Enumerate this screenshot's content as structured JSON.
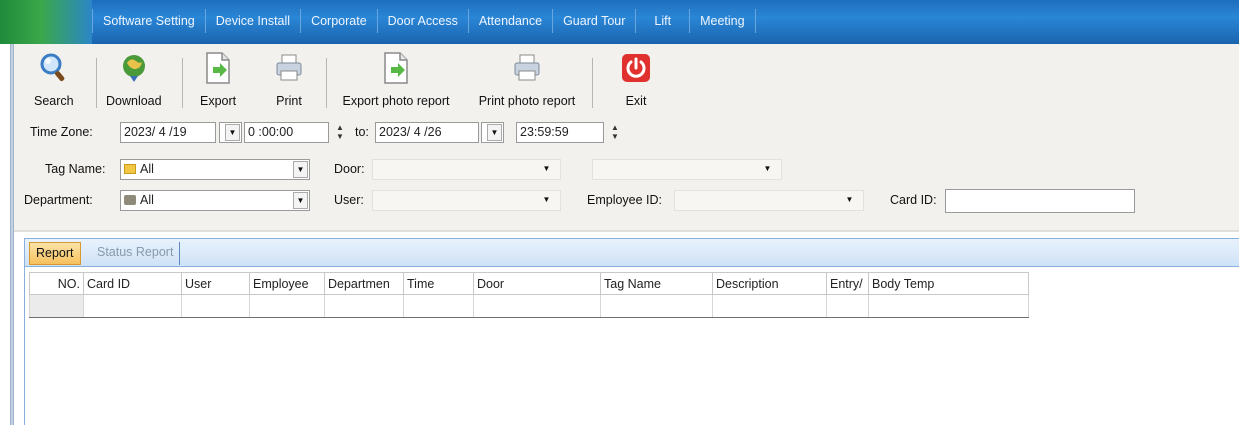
{
  "menubar": {
    "items": [
      "Software Setting",
      "Device Install",
      "Corporate",
      "Door Access",
      "Attendance",
      "Guard Tour",
      "Lift",
      "Meeting"
    ]
  },
  "toolbar": {
    "search": "Search",
    "download": "Download",
    "export": "Export",
    "print": "Print",
    "export_photo": "Export photo report",
    "print_photo": "Print photo report",
    "exit": "Exit"
  },
  "filters": {
    "time_zone_label": "Time Zone:",
    "start_date": "2023/ 4 /19",
    "start_time": "0 :00:00",
    "to_label": "to:",
    "end_date": "2023/ 4 /26",
    "end_time": "23:59:59",
    "tag_name_label": "Tag Name:",
    "tag_name_value": "All",
    "door_label": "Door:",
    "door_value": "",
    "door_second_value": "",
    "department_label": "Department:",
    "department_value": "All",
    "user_label": "User:",
    "user_value": "",
    "employee_id_label": "Employee ID:",
    "employee_id_value": "",
    "card_id_label": "Card ID:",
    "card_id_value": ""
  },
  "tabs": {
    "report": "Report",
    "status_report": "Status Report"
  },
  "table": {
    "columns": [
      "NO.",
      "Card ID",
      "User",
      "Employee",
      "Departmen",
      "Time",
      "Door",
      "Tag Name",
      "Description",
      "Entry/",
      "Body Temp"
    ]
  },
  "colors": {
    "menubar": "#2a86d6",
    "tab_active": "#f6c15e",
    "exit_red": "#e0312e"
  }
}
